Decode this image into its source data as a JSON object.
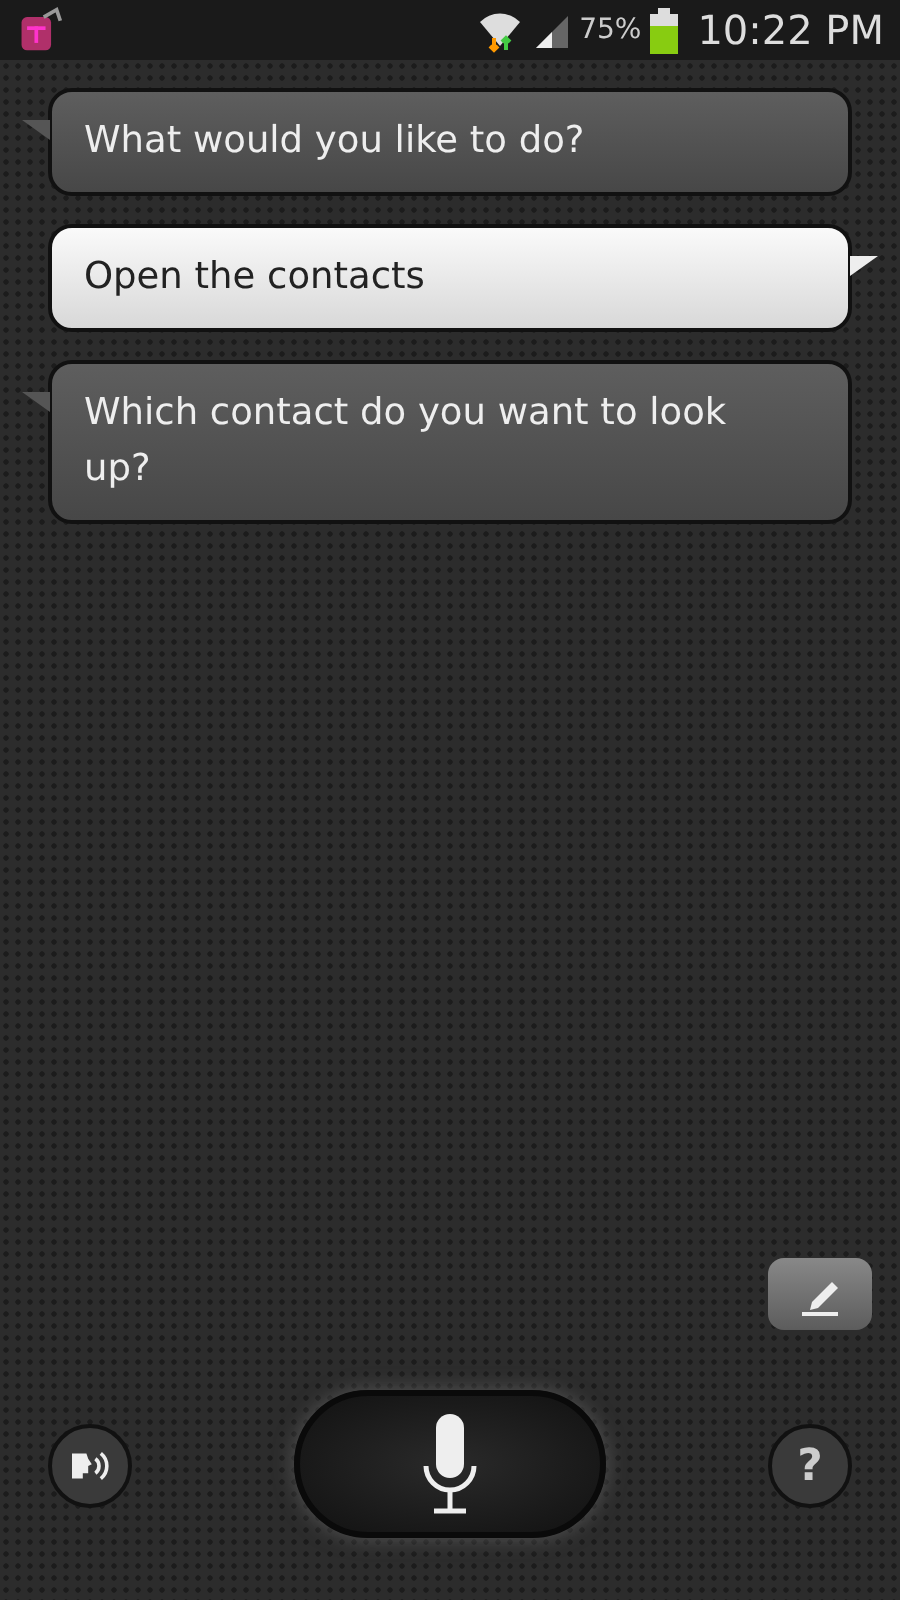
{
  "status_bar": {
    "battery": "75%",
    "time": "10:22 PM"
  },
  "messages": [
    {
      "kind": "assistant",
      "text": "What would you like to do?"
    },
    {
      "kind": "user",
      "text": "Open the contacts"
    },
    {
      "kind": "assistant",
      "text": "Which contact do you want to look up?"
    }
  ],
  "help_button": {
    "label": "?"
  }
}
